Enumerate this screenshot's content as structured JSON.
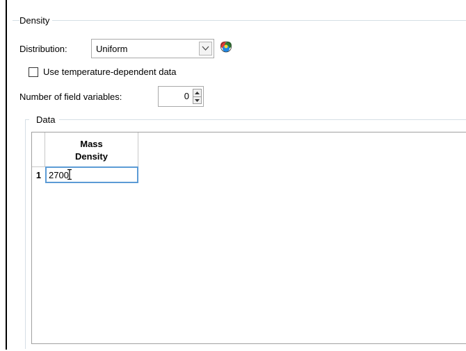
{
  "density": {
    "group_title": "Density",
    "distribution_label": "Distribution:",
    "distribution_value": "Uniform",
    "temp_dependent_label": "Use temperature-dependent data",
    "temp_dependent_checked": false,
    "field_vars_label": "Number of field variables:",
    "field_vars_value": "0"
  },
  "data": {
    "group_title": "Data",
    "columns": [
      {
        "line1": "Mass",
        "line2": "Density"
      }
    ],
    "rows": [
      {
        "index": "1",
        "value": "2700"
      }
    ]
  },
  "icons": {
    "distribution_icon": "color-palette-icon",
    "dropdown_arrow": "chevron-down-icon",
    "spin_up": "spin-up-arrow-icon",
    "spin_down": "spin-down-arrow-icon",
    "text_cursor": "text-cursor-icon"
  },
  "colors": {
    "frame_line": "#d5dfe5",
    "active_cell_border": "#5b9bd5"
  }
}
